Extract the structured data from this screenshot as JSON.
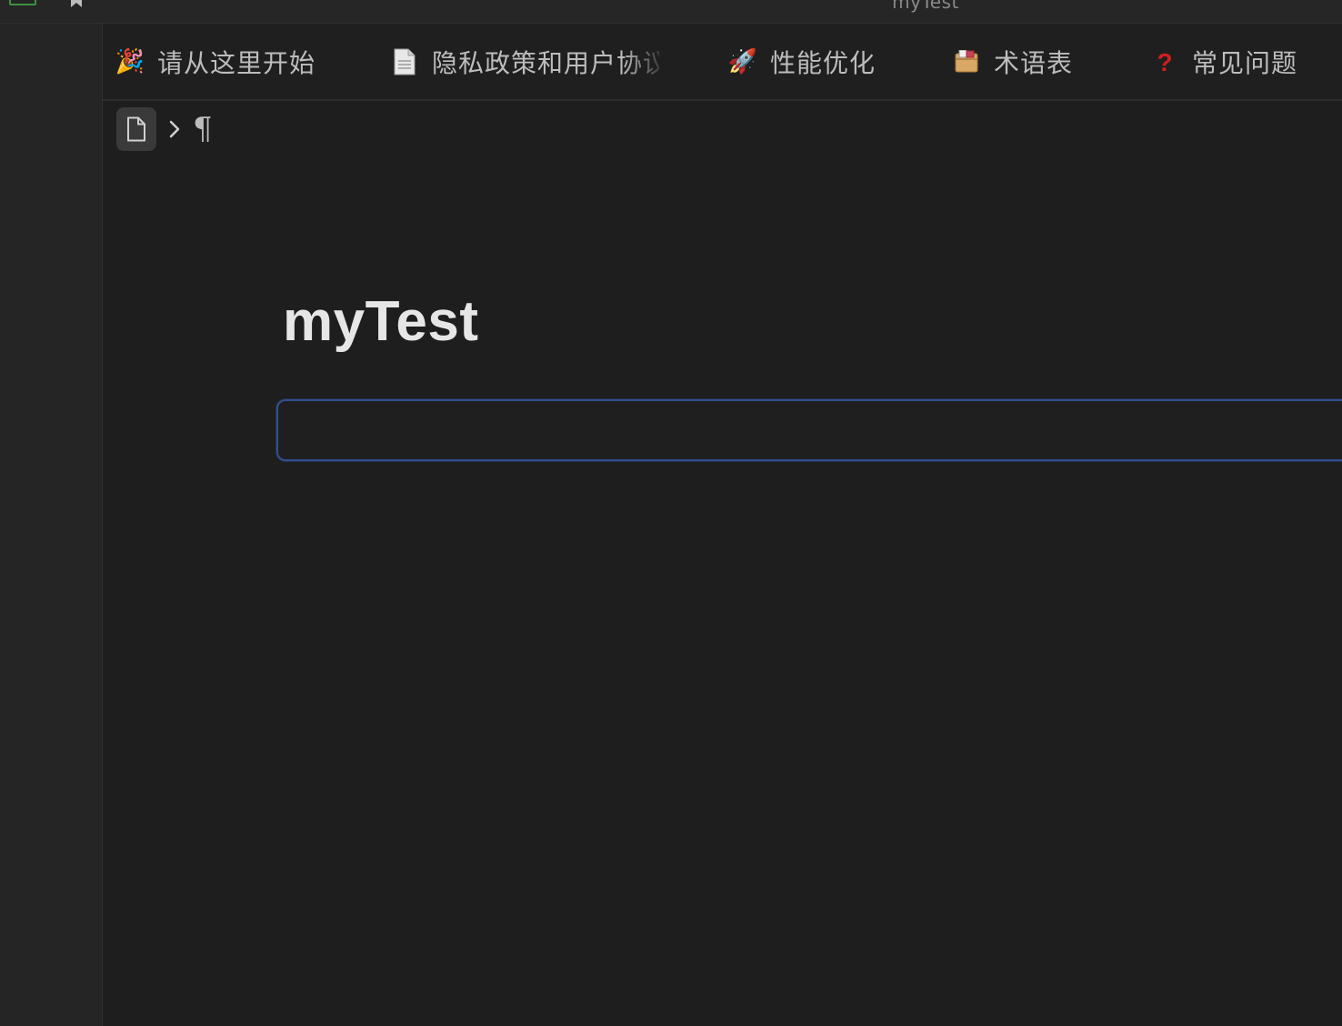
{
  "window": {
    "title": "myTest",
    "app_icon": "app-logo-icon",
    "bookmark_icon": "bookmark-icon"
  },
  "tabs": [
    {
      "icon": "party-popper-icon",
      "emoji": "🎉",
      "label": "请从这里开始"
    },
    {
      "icon": "document-icon",
      "emoji": "",
      "label": "隐私政策和用户协议"
    },
    {
      "icon": "rocket-icon",
      "emoji": "🚀",
      "label": "性能优化"
    },
    {
      "icon": "card-file-box-icon",
      "emoji": "🗃",
      "label": "术语表"
    },
    {
      "icon": "question-mark-icon",
      "emoji": "❓",
      "label": "常见问题"
    }
  ],
  "breadcrumb": {
    "doc_icon": "document-icon",
    "separator_icon": "chevron-right-icon",
    "paragraph_symbol": "¶"
  },
  "document": {
    "title": "myTest",
    "block_content": ""
  },
  "colors": {
    "background": "#1e1e1e",
    "sidebar": "#252525",
    "focus_border": "#2f4f8f",
    "text": "#bdbdbd",
    "title": "#e6e6e6"
  }
}
